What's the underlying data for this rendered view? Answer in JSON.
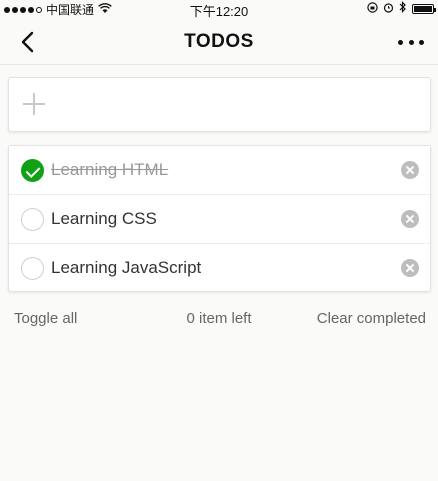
{
  "status_bar": {
    "carrier": "中国联通",
    "time": "下午12:20"
  },
  "nav": {
    "title": "TODOS",
    "back_icon": "chevron-left-icon",
    "more_icon": "more-dots-icon"
  },
  "new_todo": {
    "value": "",
    "placeholder": "",
    "icon": "plus-icon"
  },
  "todos": [
    {
      "label": "Learning HTML",
      "completed": true
    },
    {
      "label": "Learning CSS",
      "completed": false
    },
    {
      "label": "Learning JavaScript",
      "completed": false
    }
  ],
  "footer": {
    "toggle_all": "Toggle all",
    "items_left": "0 item left",
    "clear_completed": "Clear completed"
  },
  "colors": {
    "accent_green": "#10a114",
    "background": "#fafaf9"
  }
}
